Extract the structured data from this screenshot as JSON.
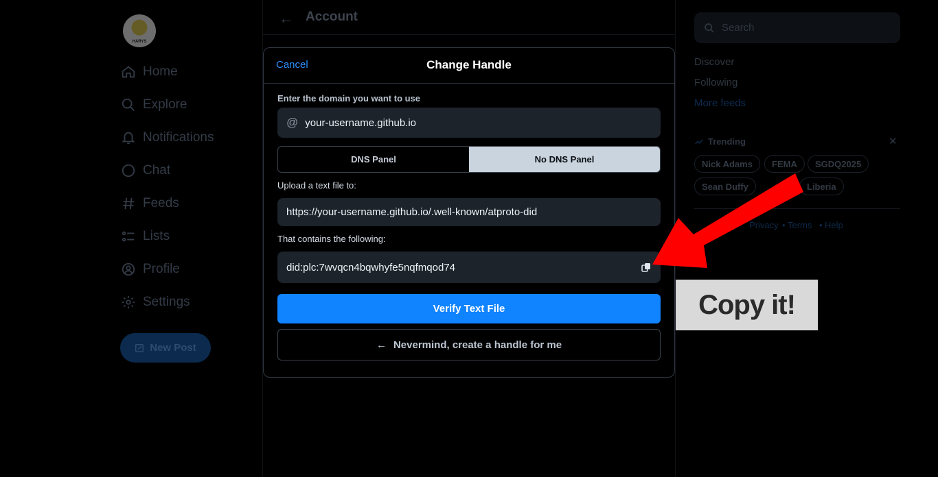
{
  "sidebar": {
    "avatar_text": "HARYS",
    "items": [
      {
        "label": "Home",
        "icon": "home-icon"
      },
      {
        "label": "Explore",
        "icon": "search-icon"
      },
      {
        "label": "Notifications",
        "icon": "bell-icon"
      },
      {
        "label": "Chat",
        "icon": "chat-icon"
      },
      {
        "label": "Feeds",
        "icon": "hash-icon"
      },
      {
        "label": "Lists",
        "icon": "list-icon"
      },
      {
        "label": "Profile",
        "icon": "profile-icon"
      },
      {
        "label": "Settings",
        "icon": "gear-icon"
      }
    ],
    "new_post": "New Post"
  },
  "header": {
    "title": "Account"
  },
  "right": {
    "search_placeholder": "Search",
    "links": [
      "Discover",
      "Following",
      "More feeds"
    ],
    "trending_label": "Trending",
    "trending": [
      "Nick Adams",
      "FEMA",
      "SGDQ2025",
      "Sean Duffy",
      "Liberia"
    ],
    "footer": [
      "Privacy",
      "Terms",
      "Help"
    ]
  },
  "modal": {
    "cancel": "Cancel",
    "title": "Change Handle",
    "domain_label": "Enter the domain you want to use",
    "domain_value": "your-username.github.io",
    "tabs": [
      "DNS Panel",
      "No DNS Panel"
    ],
    "selected_tab": "No DNS Panel",
    "upload_label": "Upload a text file to:",
    "upload_url": "https://your-username.github.io/.well-known/atproto-did",
    "contains_label": "That contains the following:",
    "did_value": "did:plc:7wvqcn4bqwhyfe5nqfmqod74",
    "verify_button": "Verify Text File",
    "nevermind_button": "Nevermind, create a handle for me"
  },
  "annotation": {
    "callout": "Copy it!",
    "arrow_color": "#ff0000"
  }
}
